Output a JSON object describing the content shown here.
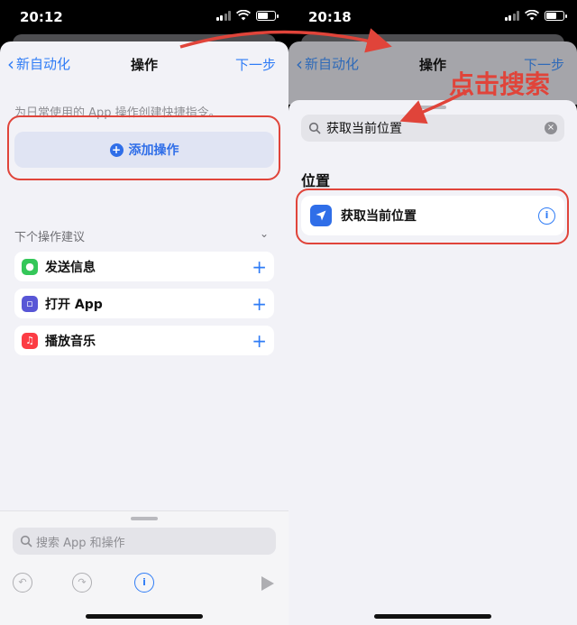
{
  "left": {
    "time": "20:12",
    "nav": {
      "back": "新自动化",
      "title": "操作",
      "next": "下一步"
    },
    "hint": "为日常使用的 App 操作创建快捷指令。",
    "add_action": "添加操作",
    "suggestions_title": "下个操作建议",
    "suggestions": [
      {
        "label": "发送信息",
        "icon": "messages-icon",
        "color": "#34c759"
      },
      {
        "label": "打开 App",
        "icon": "app-icon",
        "color": "#5856d6"
      },
      {
        "label": "播放音乐",
        "icon": "music-icon",
        "color": "#fc3c44"
      }
    ],
    "search_placeholder": "搜索 App 和操作"
  },
  "right": {
    "time": "20:18",
    "nav": {
      "back": "新自动化",
      "title": "操作",
      "next": "下一步"
    },
    "search_value": "获取当前位置",
    "section": "位置",
    "result": "获取当前位置"
  },
  "annotation": "点击搜索",
  "colors": {
    "accent": "#2f7cf6",
    "annotation": "#e0443a"
  }
}
